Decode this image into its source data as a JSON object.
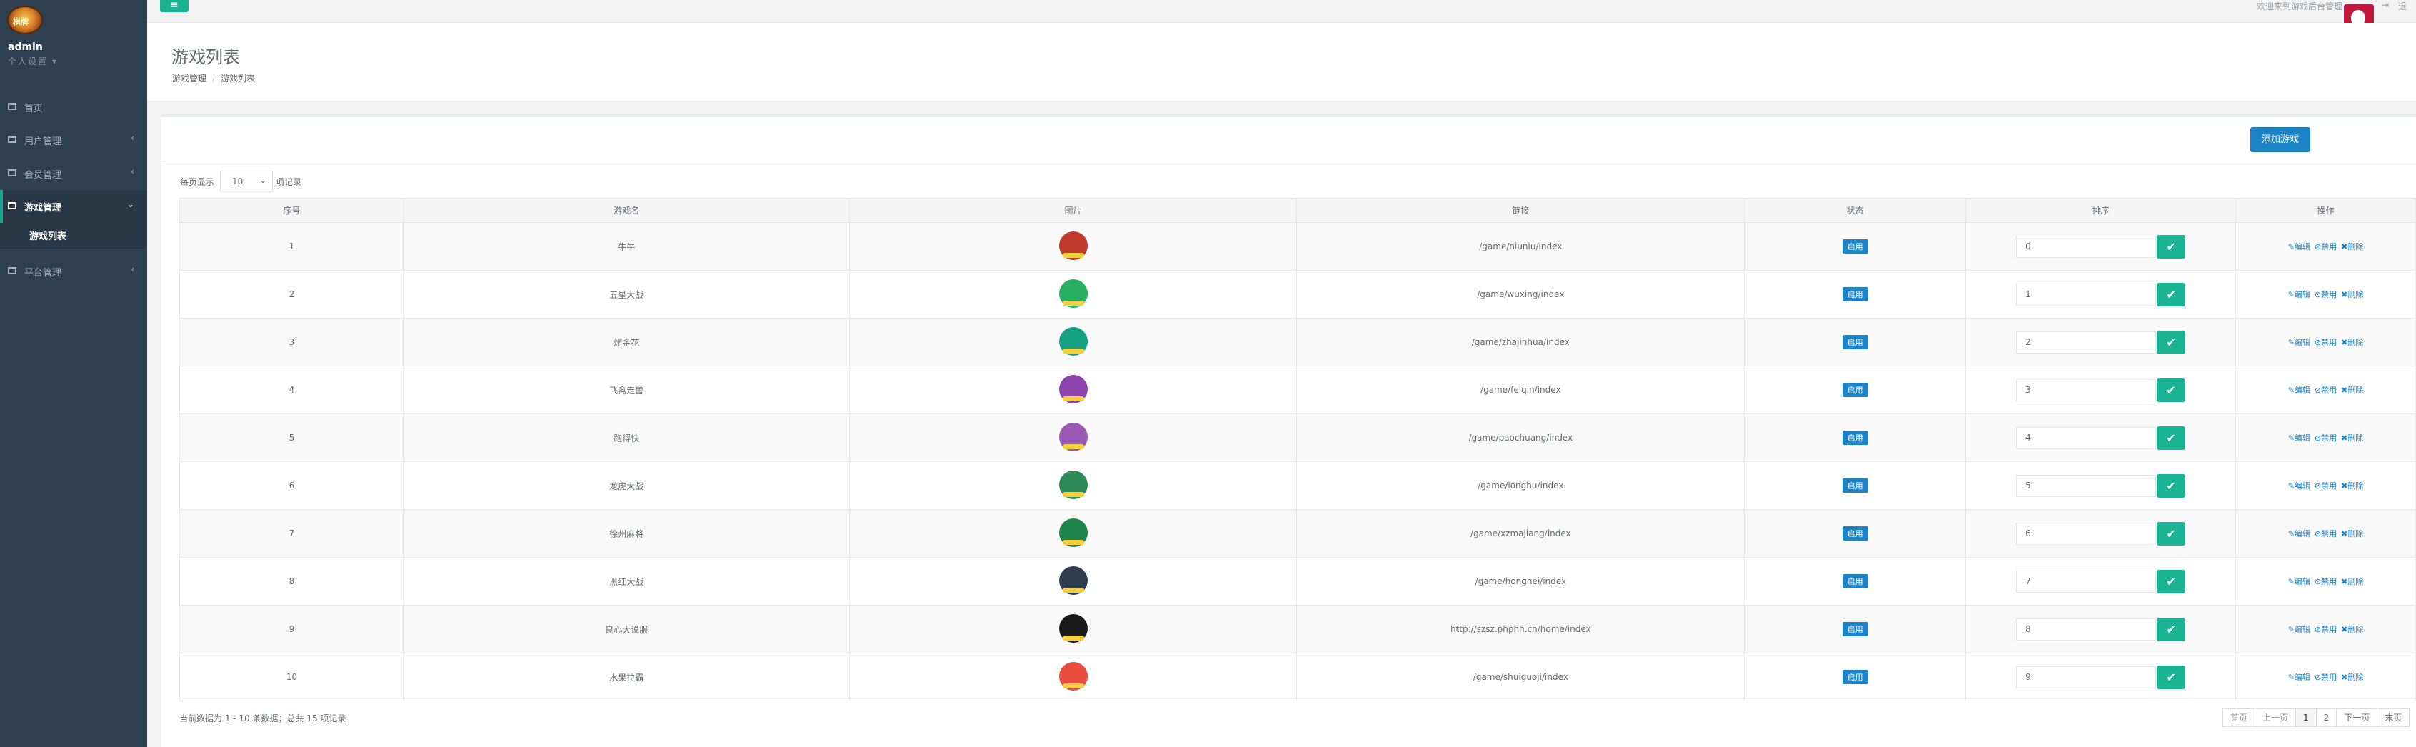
{
  "app": {
    "logo_text": "棋牌"
  },
  "profile": {
    "name": "admin",
    "settings_label": "个人设置 ▾"
  },
  "sidebar": {
    "items": [
      {
        "label": "首页",
        "arrow": ""
      },
      {
        "label": "用户管理",
        "arrow": "‹"
      },
      {
        "label": "会员管理",
        "arrow": "‹"
      },
      {
        "label": "游戏管理",
        "arrow": "⌄",
        "active": true
      },
      {
        "label": "平台管理",
        "arrow": "‹"
      }
    ],
    "sub_items": [
      {
        "label": "游戏列表"
      }
    ]
  },
  "topbar": {
    "menu_toggle": "≡",
    "welcome": "欢迎来到游戏后台管理",
    "logout_icon": "⇥",
    "logout_text": "退"
  },
  "heading": {
    "title": "游戏列表",
    "breadcrumb": [
      "游戏管理",
      "游戏列表"
    ]
  },
  "toolbar": {
    "add_button": "添加游戏"
  },
  "length_menu": {
    "prefix": "每页显示",
    "value": "10",
    "suffix": "项记录"
  },
  "table": {
    "columns": [
      "序号",
      "游戏名",
      "图片",
      "链接",
      "状态",
      "排序",
      "操作"
    ],
    "rows": [
      {
        "id": "1",
        "name": "牛牛",
        "link": "/game/niuniu/index",
        "status": "启用",
        "sort": "0",
        "img_color": "#c0392b"
      },
      {
        "id": "2",
        "name": "五星大战",
        "link": "/game/wuxing/index",
        "status": "启用",
        "sort": "1",
        "img_color": "#27ae60"
      },
      {
        "id": "3",
        "name": "炸金花",
        "link": "/game/zhajinhua/index",
        "status": "启用",
        "sort": "2",
        "img_color": "#16a085"
      },
      {
        "id": "4",
        "name": "飞禽走兽",
        "link": "/game/feiqin/index",
        "status": "启用",
        "sort": "3",
        "img_color": "#8e44ad"
      },
      {
        "id": "5",
        "name": "跑得快",
        "link": "/game/paochuang/index",
        "status": "启用",
        "sort": "4",
        "img_color": "#9b59b6"
      },
      {
        "id": "6",
        "name": "龙虎大战",
        "link": "/game/longhu/index",
        "status": "启用",
        "sort": "5",
        "img_color": "#2e8b57"
      },
      {
        "id": "7",
        "name": "徐州麻将",
        "link": "/game/xzmajiang/index",
        "status": "启用",
        "sort": "6",
        "img_color": "#1e8449"
      },
      {
        "id": "8",
        "name": "黑红大战",
        "link": "/game/honghei/index",
        "status": "启用",
        "sort": "7",
        "img_color": "#2c3e50"
      },
      {
        "id": "9",
        "name": "良心大说服",
        "link": "http://szsz.phphh.cn/home/index",
        "status": "启用",
        "sort": "8",
        "img_color": "#1a1a1a"
      },
      {
        "id": "10",
        "name": "水果拉霸",
        "link": "/game/shuiguoji/index",
        "status": "启用",
        "sort": "9",
        "img_color": "#e74c3c"
      }
    ],
    "sort_confirm_icon": "✔",
    "actions": {
      "edit": "✎编辑",
      "disable": "⊘禁用",
      "delete": "✖删除"
    }
  },
  "footer": {
    "info": "当前数据为 1 - 10 条数据；总共 15 项记录"
  },
  "pagination": [
    "首页",
    "上一页",
    "1",
    "2",
    "下一页",
    "末页"
  ],
  "colors": {
    "sidebar_bg": "#2f4050",
    "accent_green": "#1ab394",
    "primary_blue": "#1c84c6",
    "badge_red": "#c4173d"
  }
}
